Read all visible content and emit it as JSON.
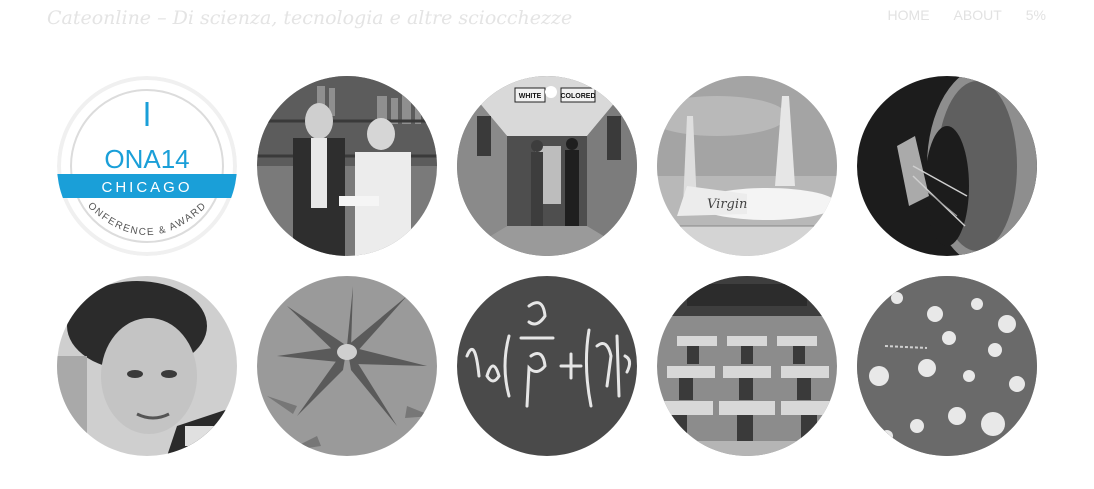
{
  "header": {
    "site_title": "Cateonline – Di scienza, tecnologia e altre sciocchezze",
    "nav": [
      {
        "label": "HOME"
      },
      {
        "label": "ABOUT"
      },
      {
        "label": "5%"
      }
    ]
  },
  "tiles": [
    {
      "name": "ona14-logo",
      "logo": {
        "line1": "ONA14",
        "line2": "CHICAGO",
        "line3": "CONFERENCE & AWARDS"
      }
    },
    {
      "name": "photo-two-men-bookshelf"
    },
    {
      "name": "photo-segregated-hallway",
      "signs": [
        "WHITE",
        "COLORED"
      ]
    },
    {
      "name": "photo-virgin-spaceship",
      "brand": "Virgin"
    },
    {
      "name": "photo-space-station"
    },
    {
      "name": "photo-young-man-portrait"
    },
    {
      "name": "photo-cannabis-plant"
    },
    {
      "name": "photo-chalkboard-equation"
    },
    {
      "name": "photo-empty-classroom"
    },
    {
      "name": "photo-bacteria-petri-dish"
    }
  ],
  "colors": {
    "header_text": "#e4e4e4",
    "ona_blue": "#1a9fd8",
    "photo_gray": "#8a8a8a"
  }
}
